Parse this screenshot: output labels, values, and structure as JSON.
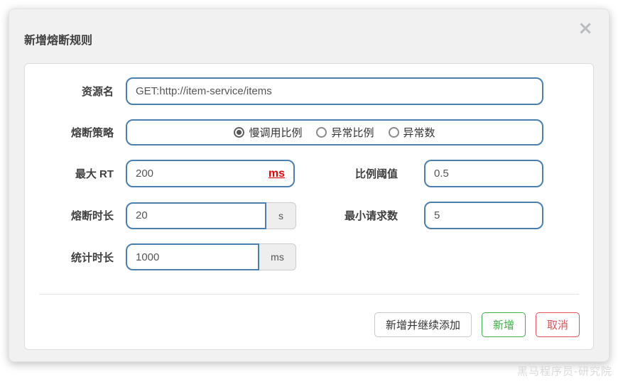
{
  "dialog": {
    "title": "新增熔断规则",
    "close_icon": "×"
  },
  "form": {
    "resource": {
      "label": "资源名",
      "value": "GET:http://item-service/items"
    },
    "strategy": {
      "label": "熔断策略",
      "options": [
        {
          "label": "慢调用比例",
          "selected": true
        },
        {
          "label": "异常比例",
          "selected": false
        },
        {
          "label": "异常数",
          "selected": false
        }
      ]
    },
    "max_rt": {
      "label": "最大 RT",
      "value": "200",
      "unit": "ms"
    },
    "ratio_threshold": {
      "label": "比例阈值",
      "value": "0.5"
    },
    "fuse_duration": {
      "label": "熔断时长",
      "value": "20",
      "unit": "s"
    },
    "min_requests": {
      "label": "最小请求数",
      "value": "5"
    },
    "stat_duration": {
      "label": "统计时长",
      "value": "1000",
      "unit": "ms"
    }
  },
  "footer": {
    "add_and_continue_label": "新增并继续添加",
    "add_label": "新增",
    "cancel_label": "取消"
  },
  "watermark": "黑马程序员-研究院",
  "colors": {
    "input_border": "#4a7fb0",
    "unit_highlight": "#e60b0b",
    "add_button": "#3fae49",
    "cancel_button": "#dd5356",
    "dialog_bg": "#f1f1f1"
  }
}
